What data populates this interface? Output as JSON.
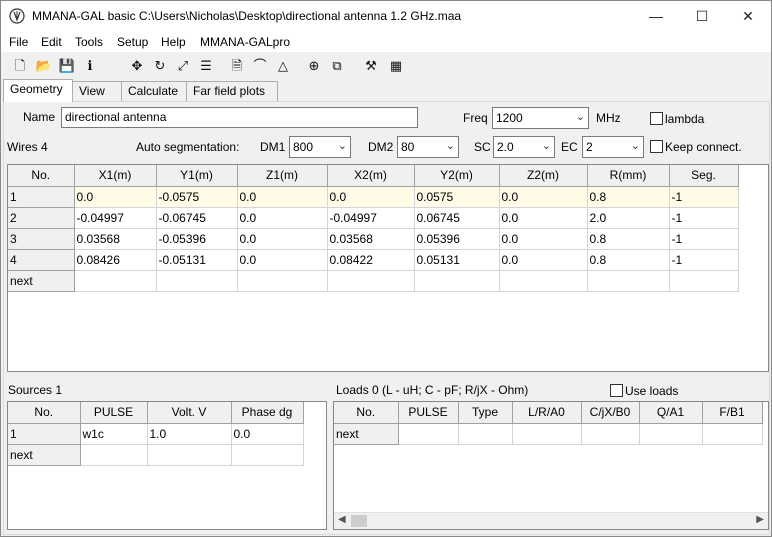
{
  "window": {
    "title": "MMANA-GAL basic C:\\Users\\Nicholas\\Desktop\\directional antenna 1.2 GHz.maa"
  },
  "menu": [
    "File",
    "Edit",
    "Tools",
    "Setup",
    "Help",
    "MMANA-GALpro"
  ],
  "toolbar": [
    {
      "name": "new-file-icon",
      "glyph": "🗋"
    },
    {
      "name": "open-folder-icon",
      "glyph": "📂"
    },
    {
      "name": "save-icon",
      "glyph": "💾"
    },
    {
      "name": "info-icon",
      "glyph": "ℹ"
    },
    {
      "name": "move-icon",
      "glyph": "✥"
    },
    {
      "name": "rotate-icon",
      "glyph": "↻"
    },
    {
      "name": "stretch-icon",
      "glyph": "⤢"
    },
    {
      "name": "wires-icon",
      "glyph": "☰"
    },
    {
      "name": "document-icon",
      "glyph": "🗎"
    },
    {
      "name": "shape-icon",
      "glyph": "⌒"
    },
    {
      "name": "triangle-icon",
      "glyph": "△"
    },
    {
      "name": "crosshair-icon",
      "glyph": "⊕"
    },
    {
      "name": "copy-icon",
      "glyph": "⧉"
    },
    {
      "name": "tools-icon",
      "glyph": "⚒"
    },
    {
      "name": "calculator-icon",
      "glyph": "▦"
    }
  ],
  "tabs": [
    "Geometry",
    "View",
    "Calculate",
    "Far field plots"
  ],
  "geometry": {
    "name_label": "Name",
    "name_value": "directional antenna",
    "freq_label": "Freq",
    "freq_value": "1200",
    "freq_unit": "MHz",
    "lambda_label": "lambda",
    "wires_label": "Wires 4",
    "autoseg_label": "Auto segmentation:",
    "dm1_label": "DM1",
    "dm1_value": "800",
    "dm2_label": "DM2",
    "dm2_value": "80",
    "sc_label": "SC",
    "sc_value": "2.0",
    "ec_label": "EC",
    "ec_value": "2",
    "keep_connect_label": "Keep connect."
  },
  "wires_table": {
    "headers": [
      "No.",
      "X1(m)",
      "Y1(m)",
      "Z1(m)",
      "X2(m)",
      "Y2(m)",
      "Z2(m)",
      "R(mm)",
      "Seg."
    ],
    "rows": [
      [
        "1",
        "0.0",
        "-0.0575",
        "0.0",
        "0.0",
        "0.0575",
        "0.0",
        "0.8",
        "-1"
      ],
      [
        "2",
        "-0.04997",
        "-0.06745",
        "0.0",
        "-0.04997",
        "0.06745",
        "0.0",
        "2.0",
        "-1"
      ],
      [
        "3",
        "0.03568",
        "-0.05396",
        "0.0",
        "0.03568",
        "0.05396",
        "0.0",
        "0.8",
        "-1"
      ],
      [
        "4",
        "0.08426",
        "-0.05131",
        "0.0",
        "0.08422",
        "0.05131",
        "0.0",
        "0.8",
        "-1"
      ],
      [
        "next",
        "",
        "",
        "",
        "",
        "",
        "",
        "",
        ""
      ]
    ]
  },
  "sources": {
    "label": "Sources 1",
    "headers": [
      "No.",
      "PULSE",
      "Volt. V",
      "Phase dg"
    ],
    "rows": [
      [
        "1",
        "w1c",
        "1.0",
        "0.0"
      ],
      [
        "next",
        "",
        "",
        ""
      ]
    ]
  },
  "loads": {
    "label": "Loads 0 (L - uH; C - pF; R/jX - Ohm)",
    "use_loads_label": "Use loads",
    "headers": [
      "No.",
      "PULSE",
      "Type",
      "L/R/A0",
      "C/jX/B0",
      "Q/A1",
      "F/B1"
    ],
    "rows": [
      [
        "next",
        "",
        "",
        "",
        "",
        "",
        ""
      ]
    ]
  }
}
